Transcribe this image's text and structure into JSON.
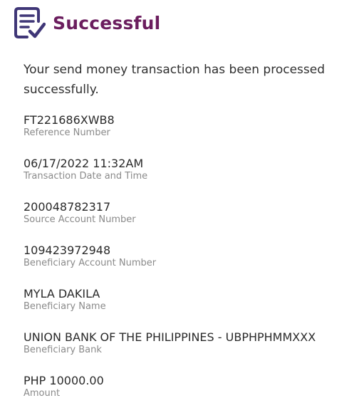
{
  "header": {
    "title": "Successful",
    "icon": "receipt-check-icon",
    "accent_color": "#6b1d5e",
    "icon_color": "#3f3677"
  },
  "message": "Your send money transaction has been processed successfully.",
  "details": [
    {
      "value": "FT221686XWB8",
      "label": "Reference Number"
    },
    {
      "value": "06/17/2022 11:32AM",
      "label": "Transaction Date and Time"
    },
    {
      "value": "200048782317",
      "label": "Source Account Number"
    },
    {
      "value": "109423972948",
      "label": "Beneficiary Account Number"
    },
    {
      "value": "MYLA DAKILA",
      "label": "Beneficiary Name"
    },
    {
      "value": "UNION BANK OF THE PHILIPPINES - UBPHPHMMXXX",
      "label": "Beneficiary Bank"
    },
    {
      "value": "PHP 10000.00",
      "label": "Amount"
    }
  ]
}
